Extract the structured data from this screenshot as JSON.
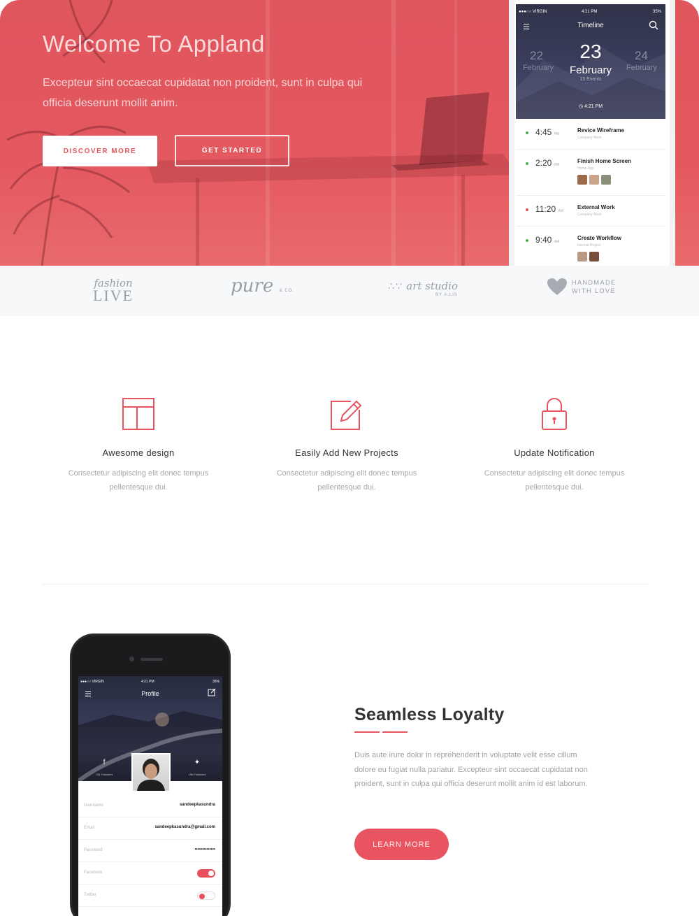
{
  "hero": {
    "title": "Welcome To Appland",
    "text": "Excepteur sint occaecat cupidatat non proident, sunt in culpa qui officia deserunt mollit anim.",
    "discover_label": "DISCOVER MORE",
    "start_label": "GET STARTED"
  },
  "timeline_phone": {
    "carrier": "●●●○○ VIRGIN",
    "time": "4:21 PM",
    "battery": "35%",
    "title": "Timeline",
    "prev_day": "22",
    "prev_month": "February",
    "day": "23",
    "month": "February",
    "events": "15 Events",
    "next_day": "24",
    "next_month": "February",
    "clock": "4:21 PM",
    "items": [
      {
        "time": "4:45",
        "suffix": "PM",
        "name": "Revice Wireframe",
        "sub": "Company Work",
        "color": "#4caf50"
      },
      {
        "time": "2:20",
        "suffix": "PM",
        "name": "Finish Home Screen",
        "sub": "Home App",
        "color": "#4caf50"
      },
      {
        "time": "11:20",
        "suffix": "AM",
        "name": "External Work",
        "sub": "Company Work",
        "color": "#e9505d"
      },
      {
        "time": "9:40",
        "suffix": "AM",
        "name": "Create Workflow",
        "sub": "Internal Project",
        "color": "#4caf50"
      }
    ]
  },
  "logos": {
    "fashion_top": "fashion",
    "fashion_bottom": "LIVE",
    "pure": "pure",
    "pure_sub": "& CO.",
    "art": "art studio",
    "art_sub": "BY A.LIS",
    "handmade_top": "HANDMADE",
    "handmade_bottom": "WITH LOVE"
  },
  "features": [
    {
      "title": "Awesome design",
      "text": "Consectetur adipiscing elit donec tempus pellentesque dui."
    },
    {
      "title": "Easily Add New Projects",
      "text": "Consectetur adipiscing elit donec tempus pellentesque dui."
    },
    {
      "title": "Update Notification",
      "text": "Consectetur adipiscing elit donec tempus pellentesque dui."
    }
  ],
  "profile_phone": {
    "carrier": "●●●○○ VIRGIN",
    "time": "4:21 PM",
    "battery": "35%",
    "title": "Profile",
    "facebook_followers": "15k Followers",
    "twitter_followers": "15k Followers",
    "username_label": "Username",
    "username_value": "sandeepkasundra",
    "email_label": "Email",
    "email_value": "sandeepkasundra@gmail.com",
    "password_label": "Password",
    "password_value": "••••••••••••••",
    "facebook_label": "Facebook",
    "twitter_label": "Twitter"
  },
  "loyalty": {
    "title": "Seamless Loyalty",
    "text": "Duis aute irure dolor in reprehenderit in voluptate velit esse cillum dolore eu fugiat nulla pariatur. Excepteur sint occaecat cupidatat non proident, sunt in culpa qui officia deserunt mollit anim id est laborum.",
    "button_label": "LEARN MORE"
  },
  "colors": {
    "accent": "#e8545f",
    "hero": "#e0565d"
  }
}
